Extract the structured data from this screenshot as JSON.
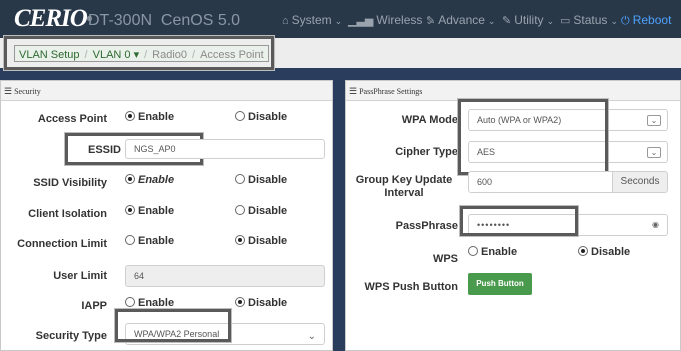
{
  "nav": {
    "logo": "CERIO",
    "model": "DT-300N",
    "os": "CenOS 5.0",
    "items": [
      {
        "label": "System",
        "icon": "home-icon"
      },
      {
        "label": "Wireless",
        "icon": "signal-icon"
      },
      {
        "label": "Advance",
        "icon": "wrench-icon"
      },
      {
        "label": "Utility",
        "icon": "wrench-icon"
      },
      {
        "label": "Status",
        "icon": "monitor-icon"
      }
    ],
    "reboot": "Reboot"
  },
  "breadcrumb": {
    "items": [
      "VLAN Setup",
      "VLAN 0",
      "Radio0",
      "Access Point"
    ]
  },
  "security": {
    "header": "Security",
    "access_point": {
      "label": "Access Point",
      "enable": "Enable",
      "disable": "Disable",
      "selected": "enable"
    },
    "essid": {
      "label": "ESSID",
      "value": "NGS_AP0"
    },
    "ssid_visibility": {
      "label": "SSID Visibility",
      "enable": "Enable",
      "disable": "Disable",
      "selected": "enable"
    },
    "client_isolation": {
      "label": "Client Isolation",
      "enable": "Enable",
      "disable": "Disable",
      "selected": "enable"
    },
    "connection_limit": {
      "label": "Connection Limit",
      "enable": "Enable",
      "disable": "Disable",
      "selected": "disable"
    },
    "user_limit": {
      "label": "User Limit",
      "value": "64"
    },
    "iapp": {
      "label": "IAPP",
      "enable": "Enable",
      "disable": "Disable",
      "selected": "disable"
    },
    "security_type": {
      "label": "Security Type",
      "value": "WPA/WPA2 Personal"
    }
  },
  "passphrase": {
    "header": "PassPhrase Settings",
    "wpa_mode": {
      "label": "WPA Mode",
      "value": "Auto (WPA or WPA2)"
    },
    "cipher_type": {
      "label": "Cipher Type",
      "value": "AES"
    },
    "group_key": {
      "label_line1": "Group Key Update",
      "label_line2": "Interval",
      "value": "600",
      "unit": "Seconds"
    },
    "passphrase": {
      "label": "PassPhrase",
      "value": "••••••••"
    },
    "wps": {
      "label": "WPS",
      "enable": "Enable",
      "disable": "Disable",
      "selected": "disable"
    },
    "wps_push": {
      "label": "WPS Push Button",
      "button": "Push Button"
    }
  },
  "colors": {
    "nav_bg": "#283849",
    "page_bg": "#2b3d5c",
    "accent_green": "#4a9a4e",
    "reboot_blue": "#4ea1ff"
  }
}
